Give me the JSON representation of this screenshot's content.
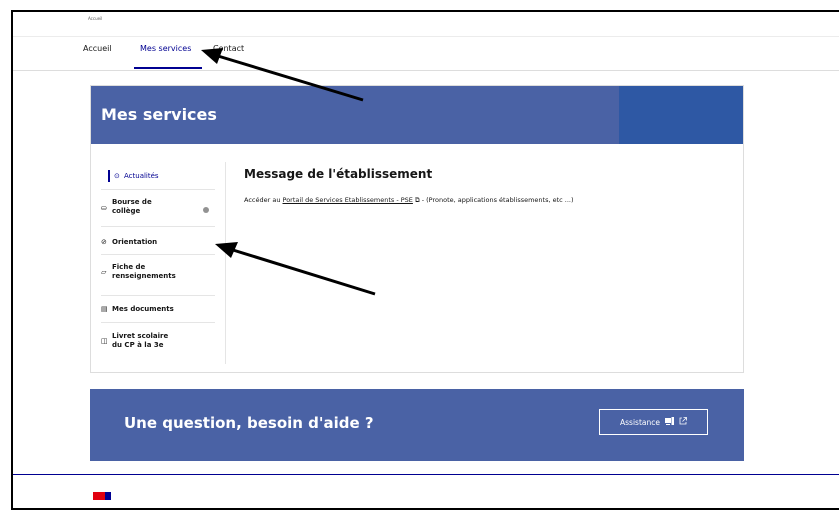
{
  "header": {
    "small_label": "Accueil"
  },
  "nav": {
    "tabs": [
      {
        "label": "Accueil",
        "active": false
      },
      {
        "label": "Mes services",
        "active": true
      },
      {
        "label": "Contact",
        "active": false
      }
    ]
  },
  "services": {
    "title": "Mes services",
    "menu": [
      {
        "icon": "clock-icon",
        "glyph": "⊙",
        "label": "Actualités",
        "active": true
      },
      {
        "icon": "wallet-icon",
        "glyph": "⛀",
        "label": "Bourse de\ncollège",
        "badge": true
      },
      {
        "icon": "compass-icon",
        "glyph": "⊘",
        "label": "Orientation"
      },
      {
        "icon": "file-edit-icon",
        "glyph": "▱",
        "label": "Fiche de\nrenseignements"
      },
      {
        "icon": "documents-icon",
        "glyph": "▤",
        "label": "Mes documents"
      },
      {
        "icon": "book-icon",
        "glyph": "◫",
        "label": "Livret scolaire\ndu CP à la 3e"
      }
    ]
  },
  "message": {
    "title": "Message de l'établissement",
    "text_before": "Accéder au ",
    "link_text": "Portail de Services Etablissements - PSE",
    "external_glyph": "⧉",
    "text_after": " - (Pronote, applications établissements, etc ...)"
  },
  "help": {
    "title": "Une question, besoin d'aide ?",
    "button_label": "Assistance",
    "button_icons": [
      "help-desk-icon",
      "external-link-icon"
    ]
  },
  "colors": {
    "primary": "#000091",
    "banner": "#4a62a5",
    "banner_square": "#2e58a4",
    "logo_red": "#e1000f"
  }
}
